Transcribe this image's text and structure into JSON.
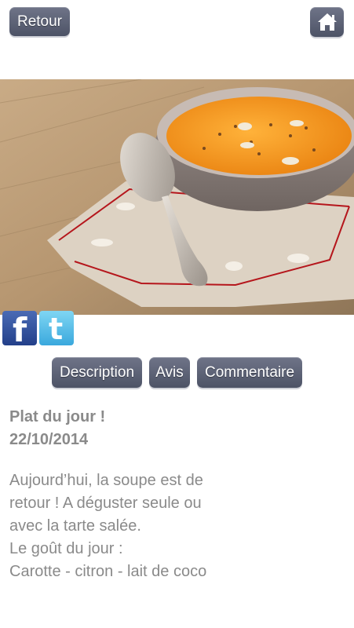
{
  "header": {
    "back_label": "Retour",
    "home_icon": "home-icon"
  },
  "social": {
    "facebook_icon": "facebook-icon",
    "twitter_icon": "twitter-icon",
    "facebook_glyph": "f",
    "twitter_glyph": "t"
  },
  "tabs": [
    {
      "label": "Description"
    },
    {
      "label": "Avis"
    },
    {
      "label": "Commentaire"
    }
  ],
  "content": {
    "title": "Plat du jour !",
    "date": "22/10/2014",
    "lines": [
      "Aujourd’hui, la soupe est de",
      "retour ! A déguster seule ou",
      "avec la tarte salée.",
      "Le goût du jour :",
      "Carotte - citron - lait de coco"
    ]
  },
  "colors": {
    "button_bg": "#5c6275",
    "text_grey": "#8a8a8a",
    "soup_orange": "#f39a1c"
  }
}
